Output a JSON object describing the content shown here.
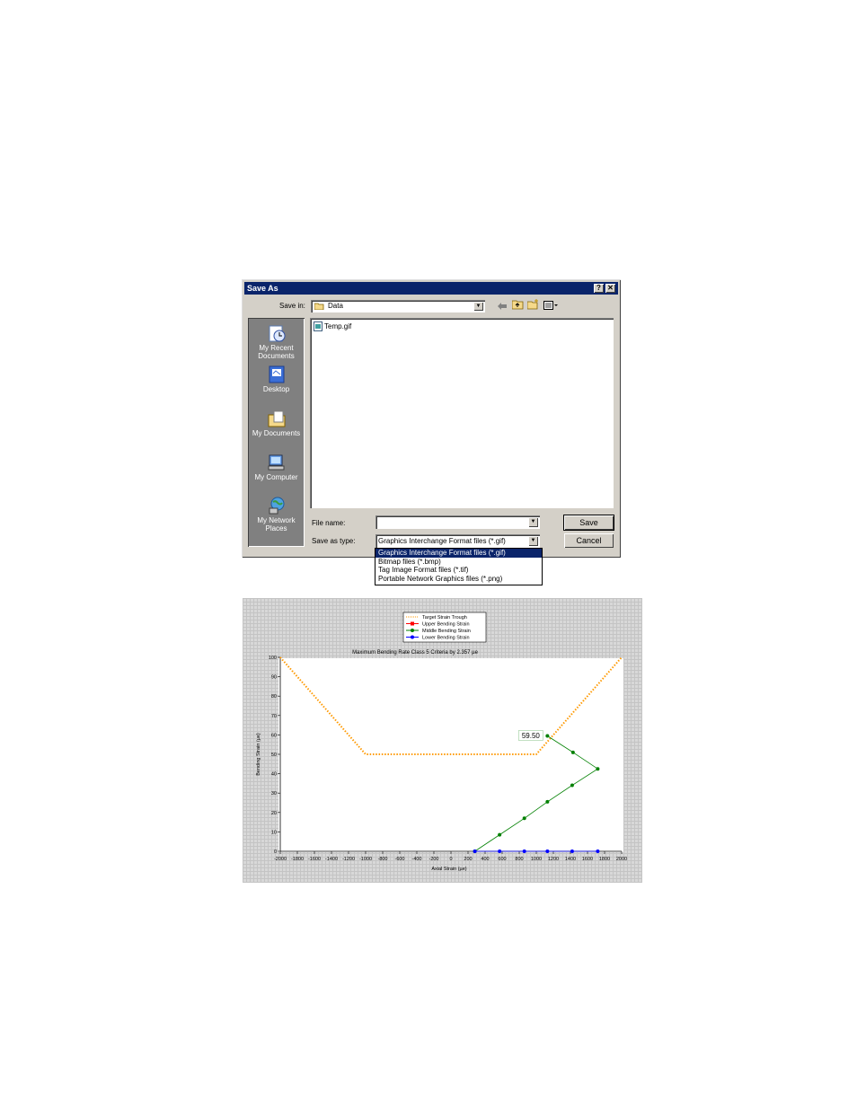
{
  "dialog": {
    "title": "Save As",
    "help_button": "?",
    "close_button": "✕",
    "save_in_label": "Save in:",
    "save_in_value": "Data",
    "places": [
      {
        "label_line1": "My Recent",
        "label_line2": "Documents",
        "icon": "recent-documents-icon"
      },
      {
        "label_line1": "Desktop",
        "label_line2": "",
        "icon": "desktop-icon"
      },
      {
        "label_line1": "My Documents",
        "label_line2": "",
        "icon": "my-documents-icon"
      },
      {
        "label_line1": "My Computer",
        "label_line2": "",
        "icon": "my-computer-icon"
      },
      {
        "label_line1": "My Network",
        "label_line2": "Places",
        "icon": "network-places-icon"
      }
    ],
    "files": [
      {
        "name": "Temp.gif",
        "icon": "gif-file-icon"
      }
    ],
    "file_name_label": "File name:",
    "file_name_value": "",
    "save_as_type_label": "Save as type:",
    "save_as_type_value": "Graphics Interchange Format files (*.gif)",
    "save_label": "Save",
    "cancel_label": "Cancel",
    "type_options": [
      "Graphics Interchange Format files (*.gif)",
      "Bitmap files (*.bmp)",
      "Tag Image Format files (*.tif)",
      "Portable Network Graphics files (*.png)"
    ],
    "selected_option_index": 0
  },
  "chart_data": {
    "type": "line",
    "title": "Maximum Bending Rate Class 5 Criteria by 2.357 µe",
    "xlabel": "Axial Strain (µe)",
    "ylabel": "Bending Strain (µe)",
    "xlim": [
      -2000,
      2000
    ],
    "ylim": [
      0,
      100
    ],
    "xticks": [
      -2000,
      -1800,
      -1600,
      -1400,
      -1200,
      -1000,
      -800,
      -600,
      -400,
      -200,
      0,
      200,
      400,
      600,
      800,
      1000,
      1200,
      1400,
      1600,
      1800,
      2000
    ],
    "yticks": [
      0,
      10,
      20,
      30,
      40,
      50,
      60,
      70,
      80,
      90,
      100
    ],
    "legend": [
      "Target Strain Trough",
      "Upper Bending Strain",
      "Middle Bending Strain",
      "Lower Bending Strain"
    ],
    "legend_position": "top-center",
    "annotation": {
      "text": "59.50",
      "x": 1130,
      "y": 59.5
    },
    "grid": false,
    "series": [
      {
        "name": "Target Strain Trough",
        "color": "#ff9900",
        "style": "dotted",
        "points": [
          [
            -2000,
            100
          ],
          [
            -1000,
            50
          ],
          [
            1000,
            50
          ],
          [
            2000,
            100
          ]
        ]
      },
      {
        "name": "Upper Bending Strain",
        "color": "#ff0000",
        "style": "line",
        "points": []
      },
      {
        "name": "Middle Bending Strain",
        "color": "#008000",
        "style": "line-markers",
        "points": [
          [
            280,
            0
          ],
          [
            570,
            8.5
          ],
          [
            860,
            17
          ],
          [
            1130,
            25.5
          ],
          [
            1420,
            34
          ],
          [
            1720,
            42.5
          ],
          [
            1430,
            51
          ],
          [
            1130,
            59.5
          ]
        ]
      },
      {
        "name": "Lower Bending Strain",
        "color": "#0000ff",
        "style": "line-markers",
        "points": [
          [
            280,
            0
          ],
          [
            570,
            0
          ],
          [
            860,
            0
          ],
          [
            1130,
            0
          ],
          [
            1420,
            0
          ],
          [
            1720,
            0
          ]
        ]
      }
    ]
  }
}
